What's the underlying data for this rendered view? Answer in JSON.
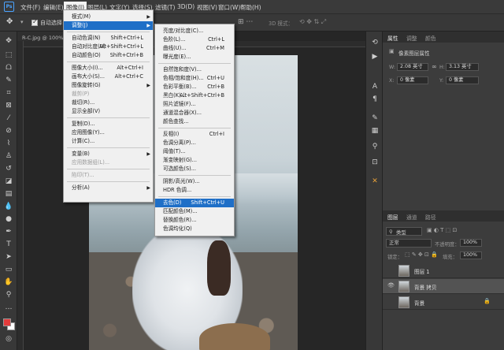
{
  "menubar": {
    "logo": "Ps",
    "items": [
      "文件(F)",
      "编辑(E)",
      "图像(I)",
      "图层(L)",
      "文字(Y)",
      "选择(S)",
      "滤镜(T)",
      "3D(D)",
      "视图(V)",
      "窗口(W)",
      "帮助(H)"
    ]
  },
  "optbar": {
    "auto_select": "自动选择：",
    "mode_3d": "3D 模式："
  },
  "document": {
    "tab": "R-C.jpg @ 100% (背景 拷贝, RGB/8#)"
  },
  "image_menu": {
    "items": [
      {
        "label": "模式(M)",
        "shortcut": "",
        "arrow": true
      },
      {
        "label": "调整(J)",
        "shortcut": "",
        "arrow": true,
        "highlight": true
      },
      {
        "sep": true
      },
      {
        "label": "自动色调(N)",
        "shortcut": "Shift+Ctrl+L"
      },
      {
        "label": "自动对比度(U)",
        "shortcut": "Alt+Shift+Ctrl+L"
      },
      {
        "label": "自动颜色(O)",
        "shortcut": "Shift+Ctrl+B"
      },
      {
        "sep": true
      },
      {
        "label": "图像大小(I)...",
        "shortcut": "Alt+Ctrl+I"
      },
      {
        "label": "画布大小(S)...",
        "shortcut": "Alt+Ctrl+C"
      },
      {
        "label": "图像旋转(G)",
        "shortcut": "",
        "arrow": true
      },
      {
        "label": "裁剪(P)",
        "shortcut": "",
        "disabled": true
      },
      {
        "label": "裁切(R)...",
        "shortcut": ""
      },
      {
        "label": "显示全部(V)",
        "shortcut": ""
      },
      {
        "sep": true
      },
      {
        "label": "复制(D)...",
        "shortcut": ""
      },
      {
        "label": "应用图像(Y)...",
        "shortcut": ""
      },
      {
        "label": "计算(C)...",
        "shortcut": ""
      },
      {
        "sep": true
      },
      {
        "label": "变量(B)",
        "shortcut": "",
        "arrow": true
      },
      {
        "label": "应用数据组(L)...",
        "shortcut": "",
        "disabled": true
      },
      {
        "sep": true
      },
      {
        "label": "陷印(T)...",
        "shortcut": "",
        "disabled": true
      },
      {
        "sep": true
      },
      {
        "label": "分析(A)",
        "shortcut": "",
        "arrow": true
      }
    ]
  },
  "adjust_menu": {
    "items": [
      {
        "label": "亮度/对比度(C)...",
        "shortcut": ""
      },
      {
        "label": "色阶(L)...",
        "shortcut": "Ctrl+L"
      },
      {
        "label": "曲线(U)...",
        "shortcut": "Ctrl+M"
      },
      {
        "label": "曝光度(E)...",
        "shortcut": ""
      },
      {
        "sep": true
      },
      {
        "label": "自然饱和度(V)...",
        "shortcut": ""
      },
      {
        "label": "色相/饱和度(H)...",
        "shortcut": "Ctrl+U"
      },
      {
        "label": "色彩平衡(B)...",
        "shortcut": "Ctrl+B"
      },
      {
        "label": "黑白(K)...",
        "shortcut": "Alt+Shift+Ctrl+B"
      },
      {
        "label": "照片滤镜(F)...",
        "shortcut": ""
      },
      {
        "label": "通道混合器(X)...",
        "shortcut": ""
      },
      {
        "label": "颜色查找...",
        "shortcut": ""
      },
      {
        "sep": true
      },
      {
        "label": "反相(I)",
        "shortcut": "Ctrl+I"
      },
      {
        "label": "色调分离(P)...",
        "shortcut": ""
      },
      {
        "label": "阈值(T)...",
        "shortcut": ""
      },
      {
        "label": "渐变映射(G)...",
        "shortcut": ""
      },
      {
        "label": "可选颜色(S)...",
        "shortcut": ""
      },
      {
        "sep": true
      },
      {
        "label": "阴影/高光(W)...",
        "shortcut": ""
      },
      {
        "label": "HDR 色调...",
        "shortcut": ""
      },
      {
        "sep": true
      },
      {
        "label": "去色(D)",
        "shortcut": "Shift+Ctrl+U",
        "highlight": true
      },
      {
        "label": "匹配颜色(M)...",
        "shortcut": ""
      },
      {
        "label": "替换颜色(R)...",
        "shortcut": ""
      },
      {
        "label": "色调均化(Q)",
        "shortcut": ""
      }
    ]
  },
  "properties": {
    "tabs": [
      "属性",
      "调整",
      "颜色"
    ],
    "section": "像素图层属性",
    "w_label": "W:",
    "w_value": "2.08 英寸",
    "h_label": "H:",
    "h_value": "3.13 英寸",
    "x_label": "X:",
    "x_value": "0 像素",
    "y_label": "Y:",
    "y_value": "0 像素"
  },
  "layers_panel": {
    "tabs": [
      "图层",
      "通道",
      "路径"
    ],
    "filter": "类型",
    "blend_mode": "正常",
    "opacity_label": "不透明度：",
    "opacity": "100%",
    "lock_label": "锁定：",
    "fill_label": "填充：",
    "fill": "100%",
    "layers": [
      {
        "name": "图层 1",
        "visible": false,
        "selected": false
      },
      {
        "name": "背景 拷贝",
        "visible": true,
        "selected": true
      },
      {
        "name": "背景",
        "visible": false,
        "selected": false,
        "locked": true
      }
    ]
  },
  "colors": {
    "accent": "#1f6fc7",
    "foreground": "#e23b3b",
    "background": "#ffffff"
  }
}
